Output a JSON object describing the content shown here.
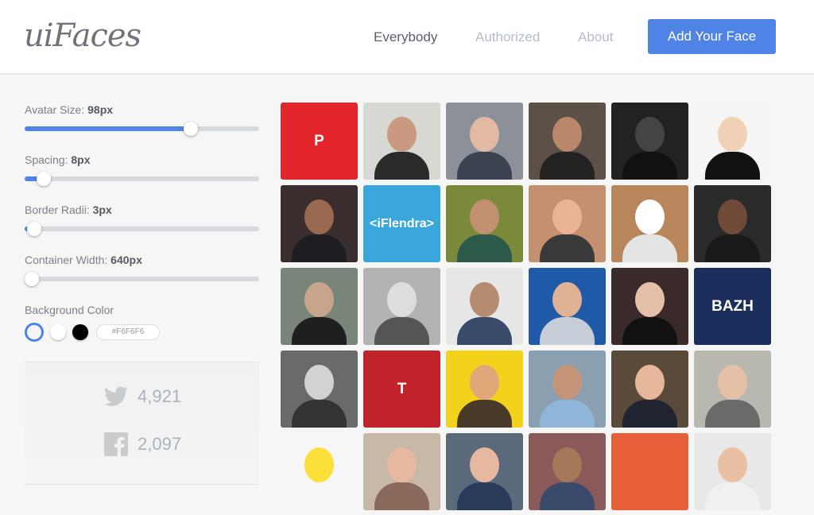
{
  "header": {
    "logo": "uiFaces",
    "nav": [
      {
        "label": "Everybody",
        "active": true
      },
      {
        "label": "Authorized",
        "active": false
      },
      {
        "label": "About",
        "active": false
      }
    ],
    "cta": "Add Your Face",
    "accent": "#4f83e6"
  },
  "controls": {
    "avatar_size": {
      "label": "Avatar Size:",
      "value": "98px",
      "fill_percent": 71
    },
    "spacing": {
      "label": "Spacing:",
      "value": "8px",
      "fill_percent": 8
    },
    "border_radii": {
      "label": "Border Radii:",
      "value": "3px",
      "fill_percent": 4
    },
    "container_width": {
      "label": "Container Width:",
      "value": "640px",
      "fill_percent": 3
    },
    "background_color": {
      "label": "Background Color",
      "swatches": [
        "#f6f6f6",
        "#ffffff",
        "#000000"
      ],
      "selected": 0,
      "hex": "#F6F6F6"
    }
  },
  "social": {
    "twitter": {
      "icon": "twitter-icon",
      "count": "4,921"
    },
    "facebook": {
      "icon": "facebook-icon",
      "count": "2,097"
    }
  },
  "avatars": [
    {
      "bg": "#e3262b",
      "text": "P"
    },
    {
      "bg": "#d8d8d3",
      "skin": "#c99a80",
      "shirt": "#2a2a2a"
    },
    {
      "bg": "#8c9199",
      "skin": "#e2b9a2",
      "shirt": "#3b4350"
    },
    {
      "bg": "#5c5048",
      "skin": "#b9876a",
      "shirt": "#222"
    },
    {
      "bg": "#222222",
      "skin": "#444",
      "shirt": "#111"
    },
    {
      "bg": "#f5f5f5",
      "skin": "#f2d2b6",
      "shirt": "#111"
    },
    {
      "bg": "#3a2d2d",
      "skin": "#9a6a50",
      "shirt": "#1e1e22"
    },
    {
      "bg": "#3aa7dc",
      "text": "<iFlendra>"
    },
    {
      "bg": "#7b8a3a",
      "skin": "#c09070",
      "shirt": "#2c5a4a"
    },
    {
      "bg": "#c49070",
      "skin": "#eab396",
      "shirt": "#3a3a3a"
    },
    {
      "bg": "#b8865a",
      "skin": "#ffffff",
      "shirt": "#e4e4e4"
    },
    {
      "bg": "#2b2b2b",
      "skin": "#6f4a38",
      "shirt": "#1a1a1a"
    },
    {
      "bg": "#7a857a",
      "skin": "#c9a48c",
      "shirt": "#1f1f1f"
    },
    {
      "bg": "#b3b3b3",
      "skin": "#dddddd",
      "shirt": "#555"
    },
    {
      "bg": "#e6e6e6",
      "skin": "#b58c6f",
      "shirt": "#3a4a6a"
    },
    {
      "bg": "#1e5aa8",
      "skin": "#e0b295",
      "shirt": "#c7cdd6"
    },
    {
      "bg": "#3a2a2a",
      "skin": "#e6bfa8",
      "shirt": "#111"
    },
    {
      "bg": "#1b2e5c",
      "text": "BAZH"
    },
    {
      "bg": "#6a6a6a",
      "skin": "#d2d2d2",
      "shirt": "#333"
    },
    {
      "bg": "#c0242a",
      "text": "T"
    },
    {
      "bg": "#f2d21a",
      "skin": "#e0a87a",
      "shirt": "#4a3a2a"
    },
    {
      "bg": "#8aa0b0",
      "skin": "#c49478",
      "shirt": "#8fb6d8"
    },
    {
      "bg": "#5a4a3a",
      "skin": "#e6b79a",
      "shirt": "#1f2430"
    },
    {
      "bg": "#b8b8b0",
      "skin": "#e3c0a6",
      "shirt": "#6a6a6a"
    },
    {
      "bg": "#f6f6f6",
      "skin": "#fbe03a",
      "shirt": "#f6f6f6"
    },
    {
      "bg": "#c8b8a8",
      "skin": "#e6b8a0",
      "shirt": "#8a6a5a"
    },
    {
      "bg": "#5a6a7a",
      "skin": "#e6b8a0",
      "shirt": "#2a3a5a"
    },
    {
      "bg": "#8a5a5a",
      "skin": "#a5785a",
      "shirt": "#3a4a6a"
    },
    {
      "bg": "#e8603a"
    },
    {
      "bg": "#e8e8e8",
      "skin": "#eac0a4",
      "shirt": "#f0f0f0"
    }
  ]
}
